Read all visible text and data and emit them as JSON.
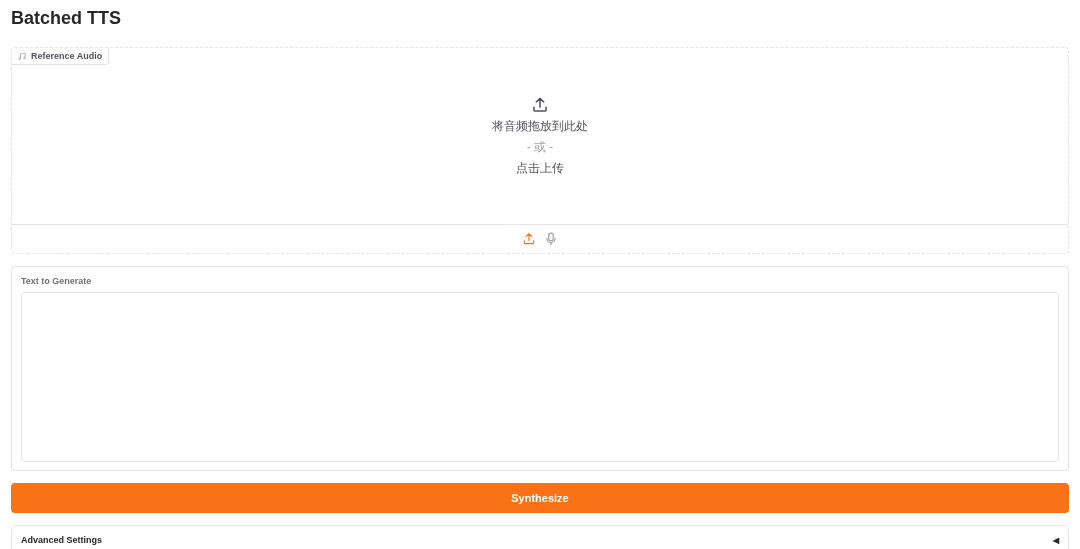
{
  "title": "Batched TTS",
  "reference_audio": {
    "label": "Reference Audio",
    "drop_text": "将音频拖放到此处",
    "or_text": "- 或 -",
    "click_text": "点击上传",
    "sources": [
      {
        "kind": "upload",
        "selected": true
      },
      {
        "kind": "microphone",
        "selected": false
      }
    ]
  },
  "text_input": {
    "label": "Text to Generate"
  },
  "synthesize_button": {
    "label": "Synthesize"
  },
  "advanced_settings": {
    "label": "Advanced Settings",
    "toggle": "◀",
    "expanded": false
  }
}
